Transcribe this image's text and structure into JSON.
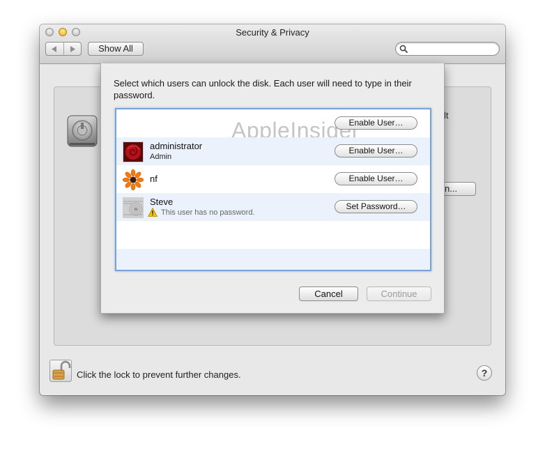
{
  "window": {
    "title": "Security & Privacy"
  },
  "toolbar": {
    "back_icon": "triangle-left",
    "forward_icon": "triangle-right",
    "show_all_label": "Show All",
    "search_placeholder": "",
    "search_value": ""
  },
  "background_pane": {
    "partial_text": "lt",
    "partial_button_label": "n...",
    "lock_label": "Click the lock to prevent further changes.",
    "help_label": "?"
  },
  "sheet": {
    "prompt": "Select which users can unlock the disk. Each user will need to type in their password.",
    "watermark": "AppleInsider",
    "users": [
      {
        "name": "",
        "role": "",
        "warning": "",
        "button_label": "Enable User…",
        "avatar": "none"
      },
      {
        "name": "administrator",
        "role": "Admin",
        "warning": "",
        "button_label": "Enable User…",
        "avatar": "red-rose"
      },
      {
        "name": "nf",
        "role": "",
        "warning": "",
        "button_label": "Enable User…",
        "avatar": "orange-flower"
      },
      {
        "name": "Steve",
        "role": "",
        "warning": "This user has no password.",
        "button_label": "Set Password…",
        "avatar": "zen-sand"
      }
    ],
    "cancel_label": "Cancel",
    "continue_label": "Continue"
  },
  "colors": {
    "table_focus_ring": "#79a3d6",
    "row_alternate": "#ebf2fc",
    "disabled_text": "#9a9a9a"
  }
}
